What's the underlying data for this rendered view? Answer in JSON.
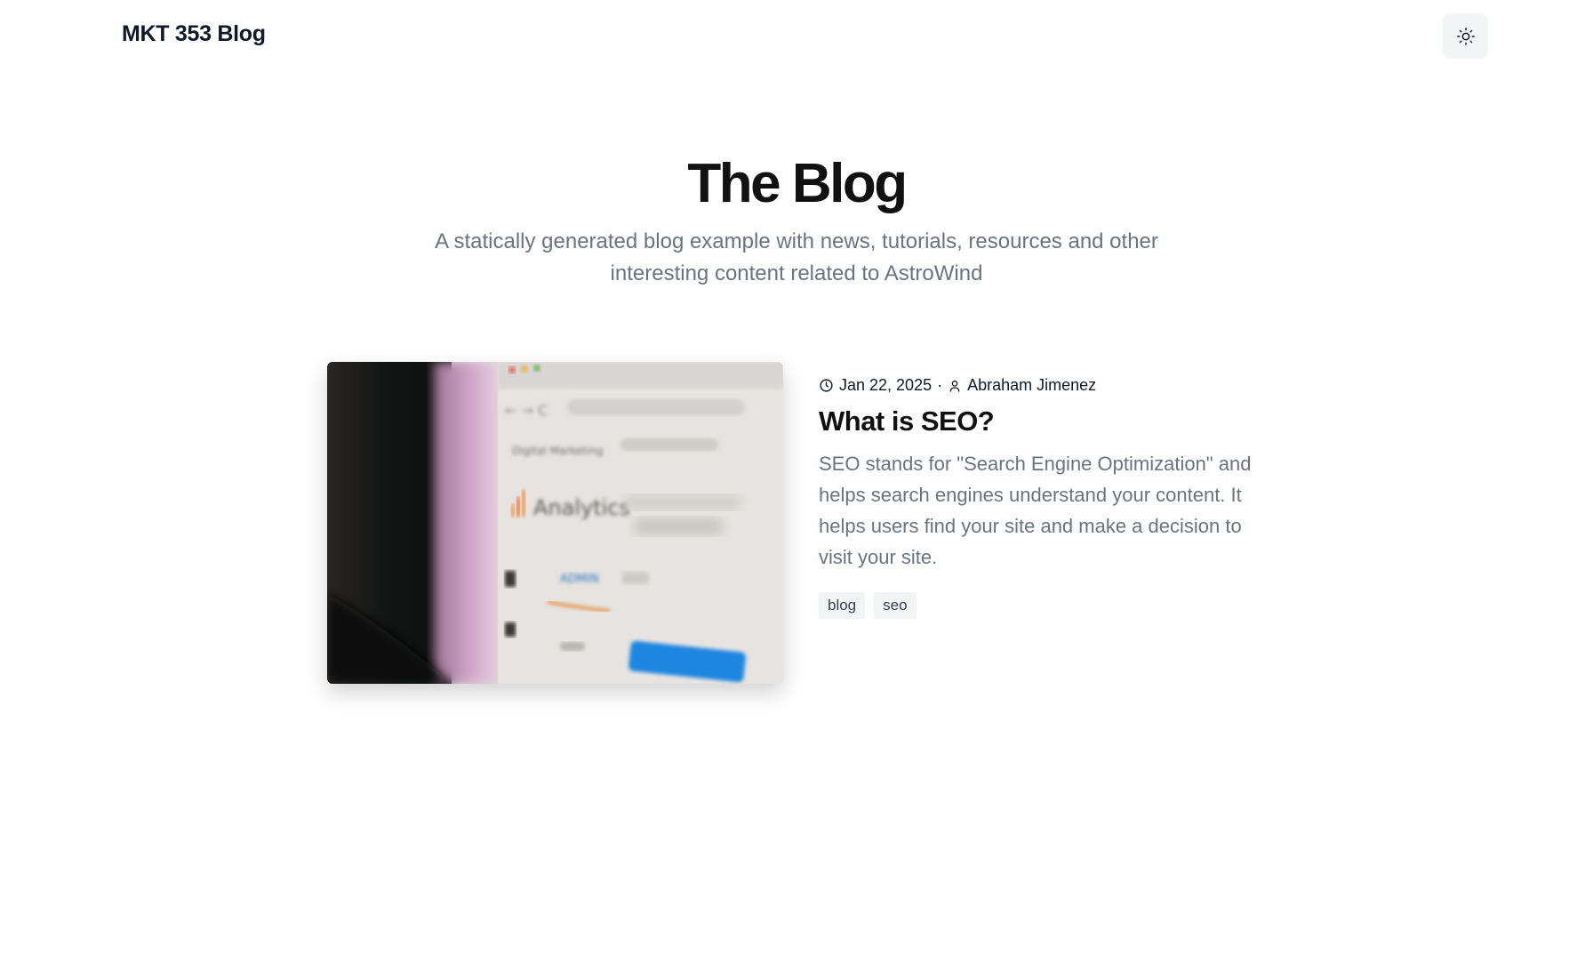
{
  "header": {
    "site_title": "MKT 353 Blog",
    "theme_toggle_icon": "sun-icon"
  },
  "hero": {
    "title": "The Blog",
    "subtitle": "A statically generated blog example with news, tutorials, resources and other interesting content related to AstroWind"
  },
  "posts": [
    {
      "image_icon": "analytics-screenshot-image",
      "image_text": {
        "digital_marketing": "Digital Marketing",
        "analytics": "Analytics",
        "admin": "ADMIN"
      },
      "date": "Jan 22, 2025",
      "separator": "·",
      "author": "Abraham Jimenez",
      "title": "What is SEO?",
      "excerpt": "SEO stands for \"Search Engine Optimization\" and helps search engines understand your content. It helps users find your site and make a decision to visit your site.",
      "tags": [
        "blog",
        "seo"
      ]
    }
  ],
  "colors": {
    "text": "#111827",
    "muted": "#6b7280",
    "tag_bg": "#f3f4f6",
    "toggle_bg": "#f3f4f6"
  }
}
